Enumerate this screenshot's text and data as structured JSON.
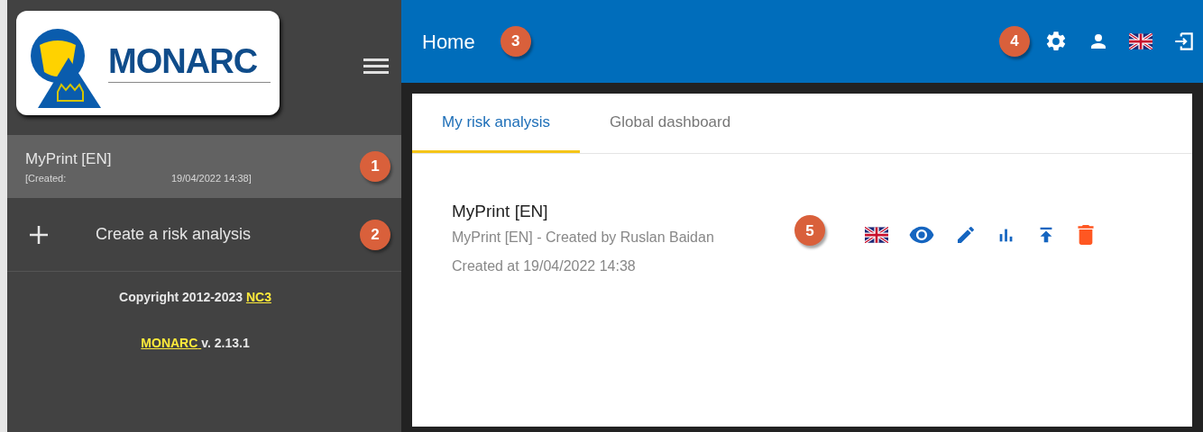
{
  "sidebar": {
    "logo_text": "MONARC",
    "analyses": [
      {
        "name": "MyPrint [EN]",
        "created_label": "[Created:",
        "created_date": "19/04/2022 14:38]",
        "selected": true,
        "callout": "1"
      }
    ],
    "create": {
      "label": "Create a risk analysis",
      "callout": "2"
    },
    "copyright": {
      "text": "Copyright 2012-2023",
      "link": "NC3"
    },
    "version": {
      "link": "MONARC",
      "text": "v. 2.13.1"
    }
  },
  "header": {
    "title": "Home",
    "title_callout": "3",
    "icons_callout": "4",
    "icons": [
      {
        "kind": "settings"
      },
      {
        "kind": "user"
      },
      {
        "kind": "flag"
      },
      {
        "kind": "logout"
      }
    ]
  },
  "tabs": [
    {
      "label": "My risk analysis",
      "selected": true
    },
    {
      "label": "Global dashboard",
      "selected": false
    }
  ],
  "analysis": {
    "title": "MyPrint [EN]",
    "subtitle": "MyPrint [EN] - Created by Ruslan Baidan",
    "created": "Created at 19/04/2022 14:38",
    "callout": "5",
    "actions": [
      {
        "kind": "flag"
      },
      {
        "kind": "view"
      },
      {
        "kind": "edit"
      },
      {
        "kind": "stats"
      },
      {
        "kind": "export"
      },
      {
        "kind": "delete"
      }
    ]
  }
}
